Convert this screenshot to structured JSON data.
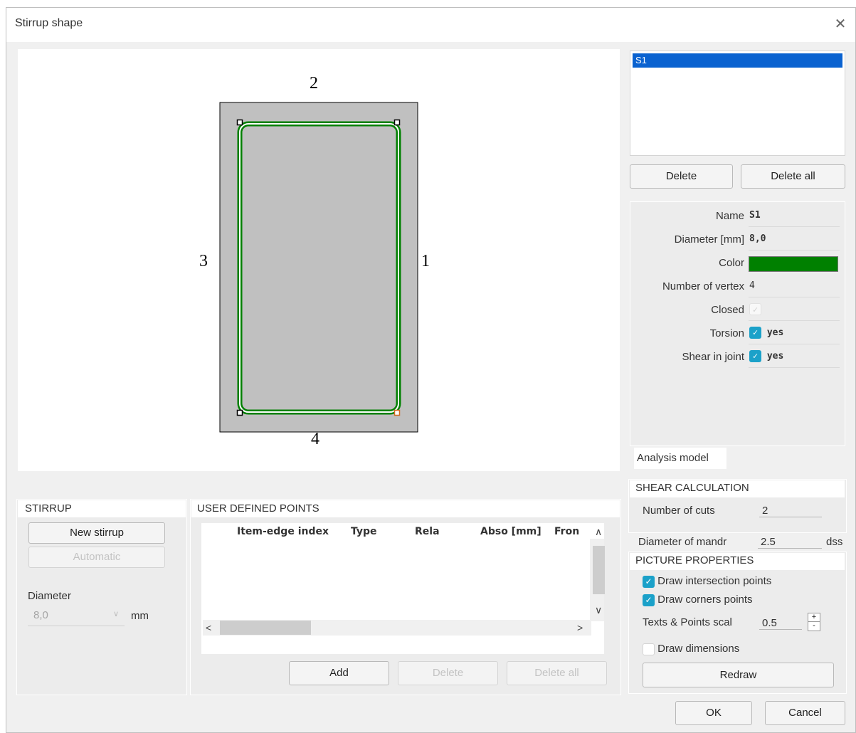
{
  "window": {
    "title": "Stirrup shape",
    "close_glyph": "✕"
  },
  "canvas": {
    "side_labels": [
      "1",
      "2",
      "3",
      "4"
    ],
    "stirrup_color": "#008000",
    "section_fill": "#c0c0c0"
  },
  "stirrup_list": {
    "items": [
      "S1"
    ],
    "delete_label": "Delete",
    "delete_all_label": "Delete all"
  },
  "properties": {
    "name_label": "Name",
    "name_value": "S1",
    "diameter_label": "Diameter [mm]",
    "diameter_value": "8,0",
    "color_label": "Color",
    "color_value": "#008000",
    "vertex_label": "Number of vertex",
    "vertex_value": "4",
    "closed_label": "Closed",
    "closed_checked": true,
    "torsion_label": "Torsion",
    "torsion_value": "yes",
    "shear_joint_label": "Shear in joint",
    "shear_joint_value": "yes"
  },
  "analysis_tab": "Analysis model",
  "shear_calc": {
    "title": "SHEAR CALCULATION",
    "cuts_label": "Number of cuts",
    "cuts_value": "2"
  },
  "mandrel": {
    "label": "Diameter of mandr",
    "value": "2.5",
    "unit": "dss"
  },
  "picture": {
    "title": "PICTURE PROPERTIES",
    "intersection_label": "Draw intersection points",
    "intersection_checked": true,
    "corners_label": "Draw corners points",
    "corners_checked": true,
    "scale_label": "Texts & Points scal",
    "scale_value": "0.5",
    "dimensions_label": "Draw dimensions",
    "dimensions_checked": false,
    "redraw_label": "Redraw"
  },
  "stirrup_panel": {
    "title": "STIRRUP",
    "new_label": "New stirrup",
    "automatic_label": "Automatic",
    "diameter_label": "Diameter",
    "diameter_value": "8,0",
    "unit": "mm"
  },
  "user_points": {
    "title": "USER DEFINED POINTS",
    "columns": [
      "Item-edge index",
      "Type",
      "Rela",
      "Abso [mm]",
      "Fron"
    ],
    "add_label": "Add",
    "delete_label": "Delete",
    "delete_all_label": "Delete all"
  },
  "footer": {
    "ok_label": "OK",
    "cancel_label": "Cancel"
  }
}
